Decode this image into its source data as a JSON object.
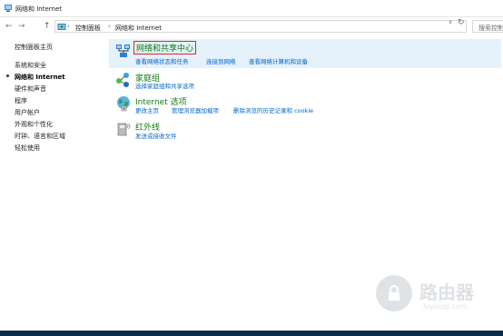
{
  "window": {
    "title": "网络和 Internet"
  },
  "address_bar": {
    "back_glyph": "←",
    "forward_glyph": "→",
    "up_glyph": "↑",
    "crumbs": [
      "控制面板",
      "网络和 Internet"
    ],
    "crumb_separator": "›",
    "dropdown_glyph": "∨",
    "refresh_glyph": "↻"
  },
  "search": {
    "placeholder": "搜索控制面板"
  },
  "sidebar": {
    "home": "控制面板主页",
    "items": [
      {
        "label": "系统和安全"
      },
      {
        "label": "网络和 Internet",
        "current": true
      },
      {
        "label": "硬件和声音"
      },
      {
        "label": "程序"
      },
      {
        "label": "用户帐户"
      },
      {
        "label": "外观和个性化"
      },
      {
        "label": "时钟、语言和区域"
      },
      {
        "label": "轻松使用"
      }
    ]
  },
  "categories": [
    {
      "icon": "network-sharing-center-icon",
      "title": "网络和共享中心",
      "highlighted": true,
      "links": [
        "查看网络状态和任务",
        "连接到网络",
        "查看网络计算机和设备"
      ]
    },
    {
      "icon": "homegroup-icon",
      "title": "家庭组",
      "links": [
        "选择家庭组和共享选项"
      ]
    },
    {
      "icon": "internet-options-icon",
      "title": "Internet 选项",
      "links": [
        "更改主页",
        "管理浏览器加载项",
        "删除浏览的历史记录和 cookie"
      ]
    },
    {
      "icon": "infrared-icon",
      "title": "红外线",
      "links": [
        "发送或接收文件"
      ]
    }
  ],
  "watermark": {
    "logo": "luyouqi-lock-logo",
    "text": "路由器",
    "url": "luyouqi.com"
  },
  "colors": {
    "link": "#0066cc",
    "category_title": "#0f7c10",
    "highlight_border": "#e0262d",
    "hover_panel": "#e5f1fb",
    "taskbar": "#0d2c4a"
  }
}
